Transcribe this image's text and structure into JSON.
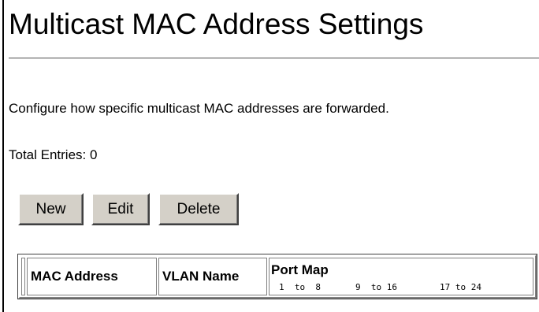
{
  "page": {
    "title": "Multicast MAC Address Settings",
    "description": "Configure how specific multicast MAC addresses are forwarded.",
    "total_entries": "Total Entries: 0"
  },
  "toolbar": {
    "new_label": "New",
    "edit_label": "Edit",
    "delete_label": "Delete"
  },
  "table": {
    "columns": {
      "mac_address": "MAC Address",
      "vlan_name": "VLAN Name",
      "port_map": "Port Map"
    },
    "port_ranges": [
      "1  to  8",
      "9  to 16",
      "17 to 24"
    ],
    "rows": []
  },
  "colors": {
    "button_face": "#d4d0c8",
    "rule_gray": "#7f7f7f",
    "text": "#000000",
    "background": "#ffffff"
  }
}
